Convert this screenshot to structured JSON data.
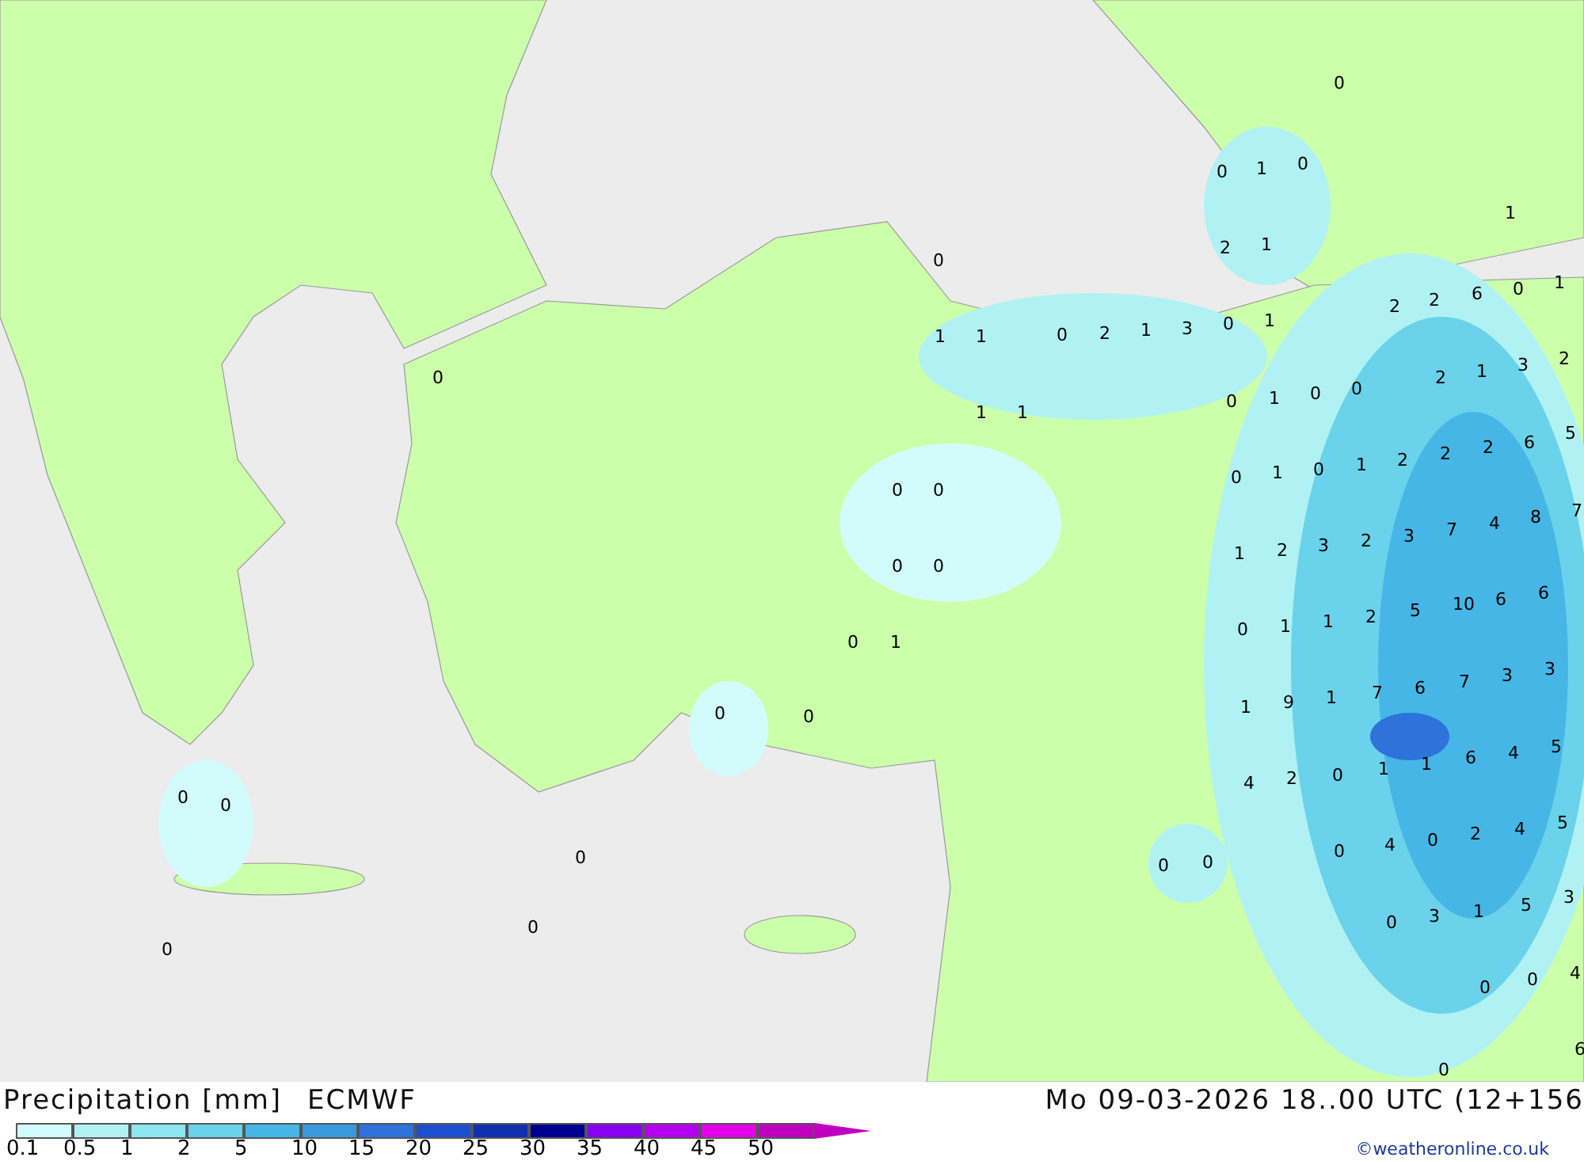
{
  "title": "Precipitation [mm]",
  "model": "ECMWF",
  "valid_time": "Mo 09-03-2026 18..00 UTC (12+156",
  "credit": "©weatheronline.co.uk",
  "legend": [
    {
      "label": "0.1",
      "color": "#d2fcfc"
    },
    {
      "label": "0.5",
      "color": "#b0f2f4"
    },
    {
      "label": "1",
      "color": "#8ee6f0"
    },
    {
      "label": "2",
      "color": "#6ad2ea"
    },
    {
      "label": "5",
      "color": "#46b6e6"
    },
    {
      "label": "10",
      "color": "#3a98de"
    },
    {
      "label": "15",
      "color": "#2e72dc"
    },
    {
      "label": "20",
      "color": "#1e4ed0"
    },
    {
      "label": "25",
      "color": "#1030b0"
    },
    {
      "label": "30",
      "color": "#000090"
    },
    {
      "label": "35",
      "color": "#8800f0"
    },
    {
      "label": "40",
      "color": "#b400f0"
    },
    {
      "label": "45",
      "color": "#e400e8"
    },
    {
      "label": "50",
      "color": "#c000c0"
    }
  ],
  "map_values": [
    "0",
    "0",
    "1",
    "0",
    "1",
    "2",
    "1",
    "0",
    "2",
    "2",
    "6",
    "0",
    "1",
    "1",
    "1",
    "0",
    "2",
    "1",
    "3",
    "0",
    "1",
    "0",
    "2",
    "1",
    "3",
    "2",
    "0",
    "1",
    "0",
    "0",
    "1",
    "1",
    "6",
    "5",
    "2",
    "2",
    "2",
    "0",
    "1",
    "0",
    "1",
    "0",
    "0",
    "8",
    "7",
    "7",
    "4",
    "2",
    "3",
    "1",
    "2",
    "3",
    "0",
    "0",
    "6",
    "2",
    "5",
    "10",
    "6",
    "0",
    "1",
    "1",
    "0",
    "1",
    "3",
    "3",
    "7",
    "6",
    "7",
    "1",
    "9",
    "1",
    "0",
    "0",
    "4",
    "5",
    "1",
    "1",
    "6",
    "4",
    "2",
    "0",
    "0",
    "0",
    "4",
    "5",
    "4",
    "0",
    "2",
    "0",
    "0",
    "0",
    "0",
    "5",
    "3",
    "0",
    "3",
    "1",
    "0",
    "0",
    "0",
    "4",
    "0",
    "0",
    "6"
  ]
}
